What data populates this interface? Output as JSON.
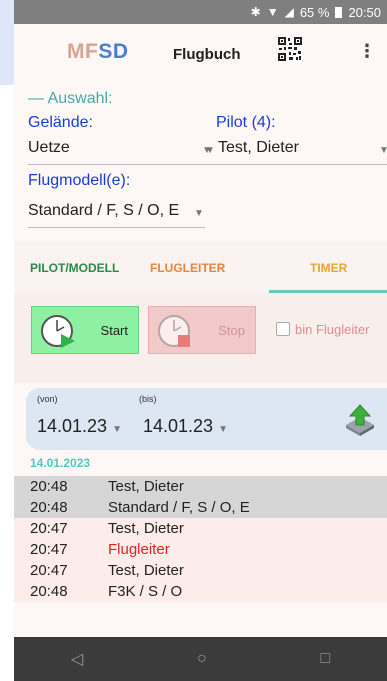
{
  "status_bar": {
    "battery": "65 %",
    "time": "20:50"
  },
  "app_bar": {
    "logo": "MFSD",
    "title": "Flugbuch",
    "menu_glyph": "⋮"
  },
  "auswahl": {
    "title": "— Auswahl:",
    "gelaende_label": "Gelände:",
    "gelaende_value": "Uetze",
    "pilot_label": "Pilot (4):",
    "pilot_value": "Test, Dieter",
    "flugmodell_label": "Flugmodell(e):",
    "flugmodell_value": "Standard / F, S / O, E"
  },
  "tabs": [
    {
      "label": "PILOT/MODELL",
      "color": "#2a8a4a"
    },
    {
      "label": "FLUGLEITER",
      "color": "#e8843c"
    },
    {
      "label": "TIMER",
      "color": "#e6a72c"
    }
  ],
  "timer": {
    "start_label": "Start",
    "stop_label": "Stop",
    "flugleiter_label": "bin Flugleiter"
  },
  "date_filter": {
    "von_label": "(von)",
    "von_value": "14.01.23",
    "bis_label": "(bis)",
    "bis_value": "14.01.23"
  },
  "log": {
    "date_header": "14.01.2023",
    "rows": [
      {
        "time": "20:48",
        "text": "Test, Dieter"
      },
      {
        "time": "20:48",
        "text": "Standard / F, S / O, E"
      },
      {
        "time": "20:47",
        "text": "Test, Dieter"
      },
      {
        "time": "20:47",
        "text": "Flugleiter"
      },
      {
        "time": "20:47",
        "text": "Test, Dieter"
      },
      {
        "time": "20:48",
        "text": "F3K / S / O"
      }
    ]
  },
  "nav": {
    "back": "◁",
    "home": "○",
    "recents": "□"
  }
}
